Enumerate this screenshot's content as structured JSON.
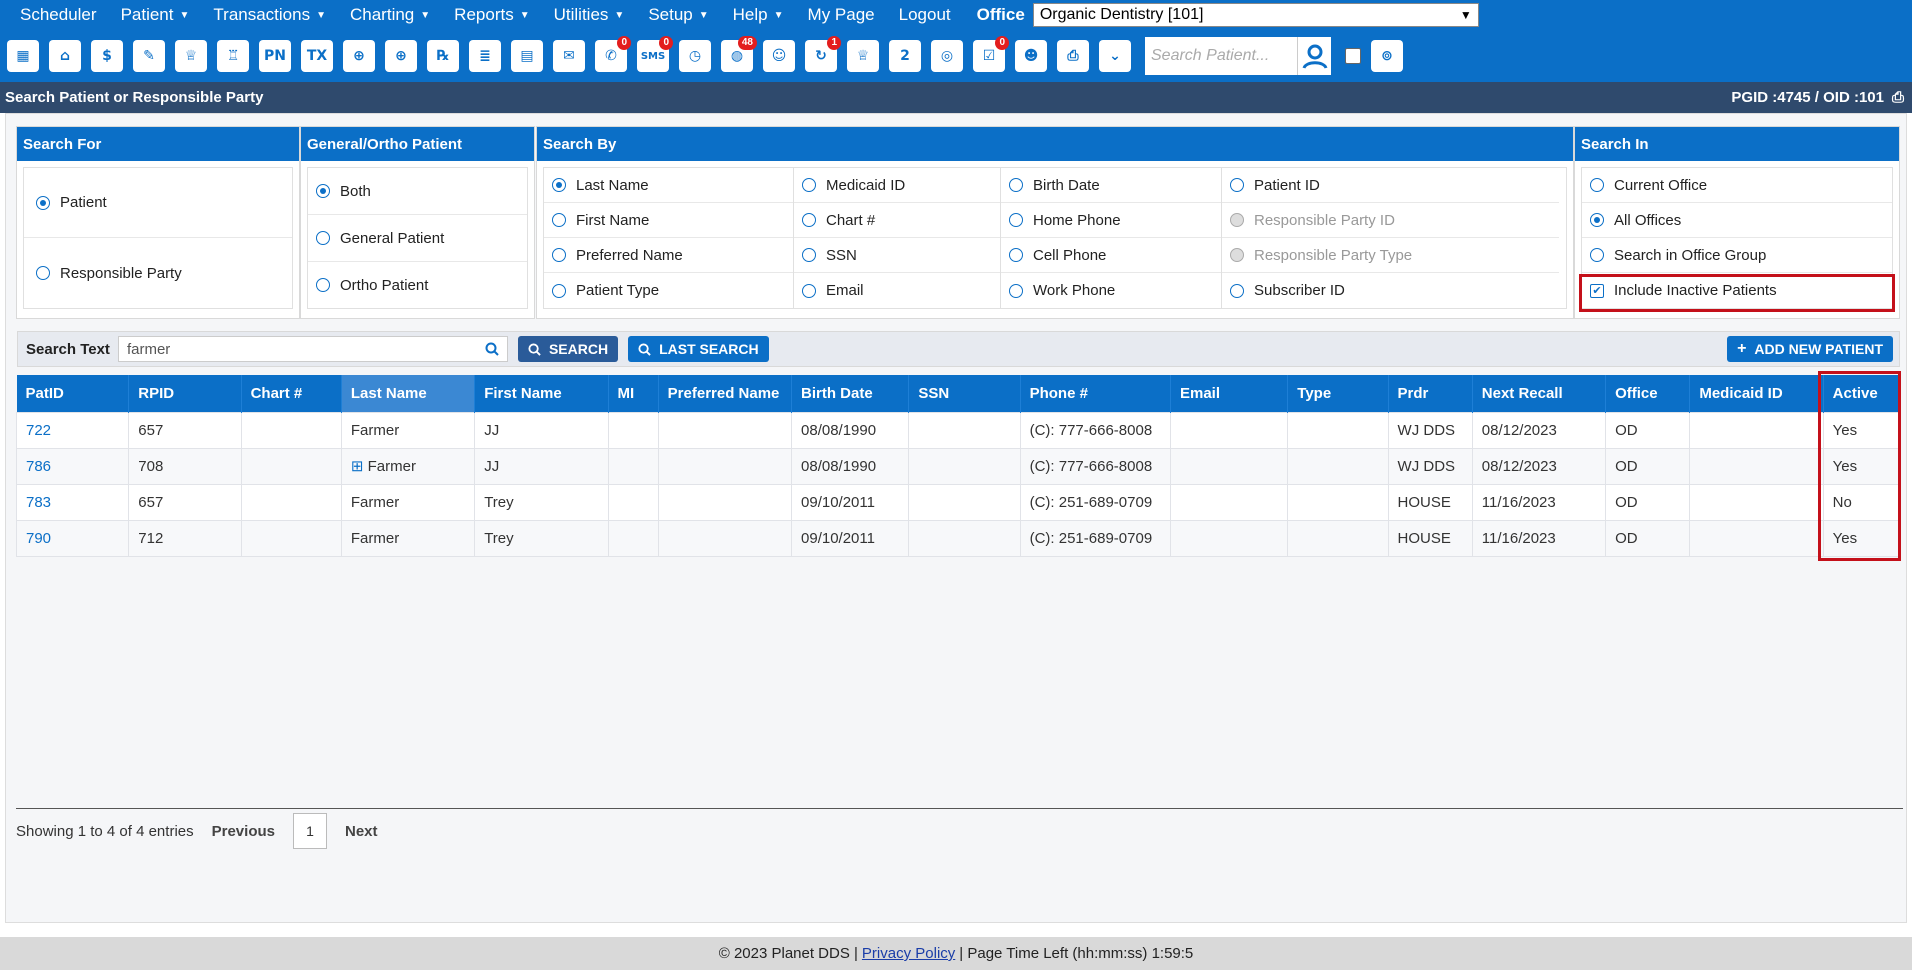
{
  "menu": {
    "items": [
      {
        "label": "Scheduler",
        "caret": false
      },
      {
        "label": "Patient",
        "caret": true
      },
      {
        "label": "Transactions",
        "caret": true
      },
      {
        "label": "Charting",
        "caret": true
      },
      {
        "label": "Reports",
        "caret": true
      },
      {
        "label": "Utilities",
        "caret": true
      },
      {
        "label": "Setup",
        "caret": true
      },
      {
        "label": "Help",
        "caret": true
      },
      {
        "label": "My Page",
        "caret": false
      },
      {
        "label": "Logout",
        "caret": false
      }
    ],
    "office_label": "Office",
    "office_value": "Organic Dentistry [101]"
  },
  "toolbar": {
    "icons": [
      {
        "name": "calendar-icon",
        "glyph": "▦"
      },
      {
        "name": "home-icon",
        "glyph": "⌂"
      },
      {
        "name": "dollar-icon",
        "glyph": "$"
      },
      {
        "name": "edit-icon",
        "glyph": "✎"
      },
      {
        "name": "tooth-icon",
        "glyph": "♕"
      },
      {
        "name": "ortho-tooth-icon",
        "glyph": "♖"
      },
      {
        "name": "progress-notes-icon",
        "glyph": "PN"
      },
      {
        "name": "treatment-icon",
        "glyph": "TX"
      },
      {
        "name": "add-patient-icon",
        "glyph": "⊕"
      },
      {
        "name": "add-family-icon",
        "glyph": "⊕"
      },
      {
        "name": "prescription-icon",
        "glyph": "℞"
      },
      {
        "name": "notes-icon",
        "glyph": "≣"
      },
      {
        "name": "document-icon",
        "glyph": "▤"
      },
      {
        "name": "mail-icon",
        "glyph": "✉"
      },
      {
        "name": "chat-icon",
        "glyph": "✆",
        "badge": "0"
      },
      {
        "name": "sms-icon",
        "glyph": "SMS",
        "badge": "0"
      },
      {
        "name": "clock-icon",
        "glyph": "◷"
      },
      {
        "name": "globe-users-icon",
        "glyph": "◍",
        "badge": "48"
      },
      {
        "name": "support-icon",
        "glyph": "☺"
      },
      {
        "name": "recall-icon",
        "glyph": "↻",
        "badge": "1"
      },
      {
        "name": "tooth-chart-icon",
        "glyph": "♕"
      },
      {
        "name": "tooth-2-icon",
        "glyph": "2"
      },
      {
        "name": "web-icon",
        "glyph": "◎"
      },
      {
        "name": "forms-icon",
        "glyph": "☑",
        "badge": "0"
      },
      {
        "name": "family-icon",
        "glyph": "☻"
      },
      {
        "name": "print-icon",
        "glyph": "⎙"
      },
      {
        "name": "more-icon",
        "glyph": "⌄"
      }
    ],
    "search_placeholder": "Search Patient..."
  },
  "titlebar": {
    "title": "Search Patient or Responsible Party",
    "ids": "PGID :4745  /  OID :101"
  },
  "search_for": {
    "header": "Search For",
    "options": [
      {
        "label": "Patient",
        "selected": true
      },
      {
        "label": "Responsible Party",
        "selected": false
      }
    ]
  },
  "general_ortho": {
    "header": "General/Ortho Patient",
    "options": [
      {
        "label": "Both",
        "selected": true
      },
      {
        "label": "General Patient",
        "selected": false
      },
      {
        "label": "Ortho Patient",
        "selected": false
      }
    ]
  },
  "search_by": {
    "header": "Search By",
    "columns": [
      [
        {
          "label": "Last Name",
          "selected": true
        },
        {
          "label": "First Name"
        },
        {
          "label": "Preferred Name"
        },
        {
          "label": "Patient Type"
        }
      ],
      [
        {
          "label": "Medicaid ID"
        },
        {
          "label": "Chart #"
        },
        {
          "label": "SSN"
        },
        {
          "label": "Email"
        }
      ],
      [
        {
          "label": "Birth Date"
        },
        {
          "label": "Home Phone"
        },
        {
          "label": "Cell Phone"
        },
        {
          "label": "Work Phone"
        }
      ],
      [
        {
          "label": "Patient ID"
        },
        {
          "label": "Responsible Party ID",
          "disabled": true
        },
        {
          "label": "Responsible Party Type",
          "disabled": true
        },
        {
          "label": "Subscriber ID"
        }
      ]
    ]
  },
  "search_in": {
    "header": "Search In",
    "options": [
      {
        "label": "Current Office",
        "selected": false
      },
      {
        "label": "All Offices",
        "selected": true
      },
      {
        "label": "Search in Office Group",
        "selected": false
      }
    ],
    "include_inactive": "Include Inactive Patients"
  },
  "search_bar": {
    "label": "Search Text",
    "value": "farmer",
    "search_btn": "SEARCH",
    "last_search_btn": "LAST SEARCH",
    "add_btn": "ADD NEW PATIENT"
  },
  "table": {
    "headers": [
      "PatID",
      "RPID",
      "Chart #",
      "Last Name",
      "First Name",
      "MI",
      "Preferred Name",
      "Birth Date",
      "SSN",
      "Phone #",
      "Email",
      "Type",
      "Prdr",
      "Next Recall",
      "Office",
      "Medicaid ID",
      "Active"
    ],
    "rows": [
      [
        "722",
        "657",
        "",
        "Farmer",
        "JJ",
        "",
        "",
        "08/08/1990",
        "",
        "(C): 777-666-8008",
        "",
        "",
        "WJ DDS",
        "08/12/2023",
        "OD",
        "",
        "Yes"
      ],
      [
        "786",
        "708",
        "",
        "Farmer",
        "JJ",
        "",
        "",
        "08/08/1990",
        "",
        "(C): 777-666-8008",
        "",
        "",
        "WJ DDS",
        "08/12/2023",
        "OD",
        "",
        "Yes"
      ],
      [
        "783",
        "657",
        "",
        "Farmer",
        "Trey",
        "",
        "",
        "09/10/2011",
        "",
        "(C): 251-689-0709",
        "",
        "",
        "HOUSE",
        "11/16/2023",
        "OD",
        "",
        "No"
      ],
      [
        "790",
        "712",
        "",
        "Farmer",
        "Trey",
        "",
        "",
        "09/10/2011",
        "",
        "(C): 251-689-0709",
        "",
        "",
        "HOUSE",
        "11/16/2023",
        "OD",
        "",
        "Yes"
      ]
    ]
  },
  "pager": {
    "info": "Showing 1 to 4 of 4 entries",
    "prev": "Previous",
    "page": "1",
    "next": "Next"
  },
  "footer": {
    "copyright": "© 2023 Planet DDS |",
    "privacy": "Privacy Policy",
    "time_left": "|  Page Time Left (hh:mm:ss) 1:59:5"
  },
  "colors": {
    "brand": "#0b6fc7",
    "highlight": "#c4101a"
  }
}
